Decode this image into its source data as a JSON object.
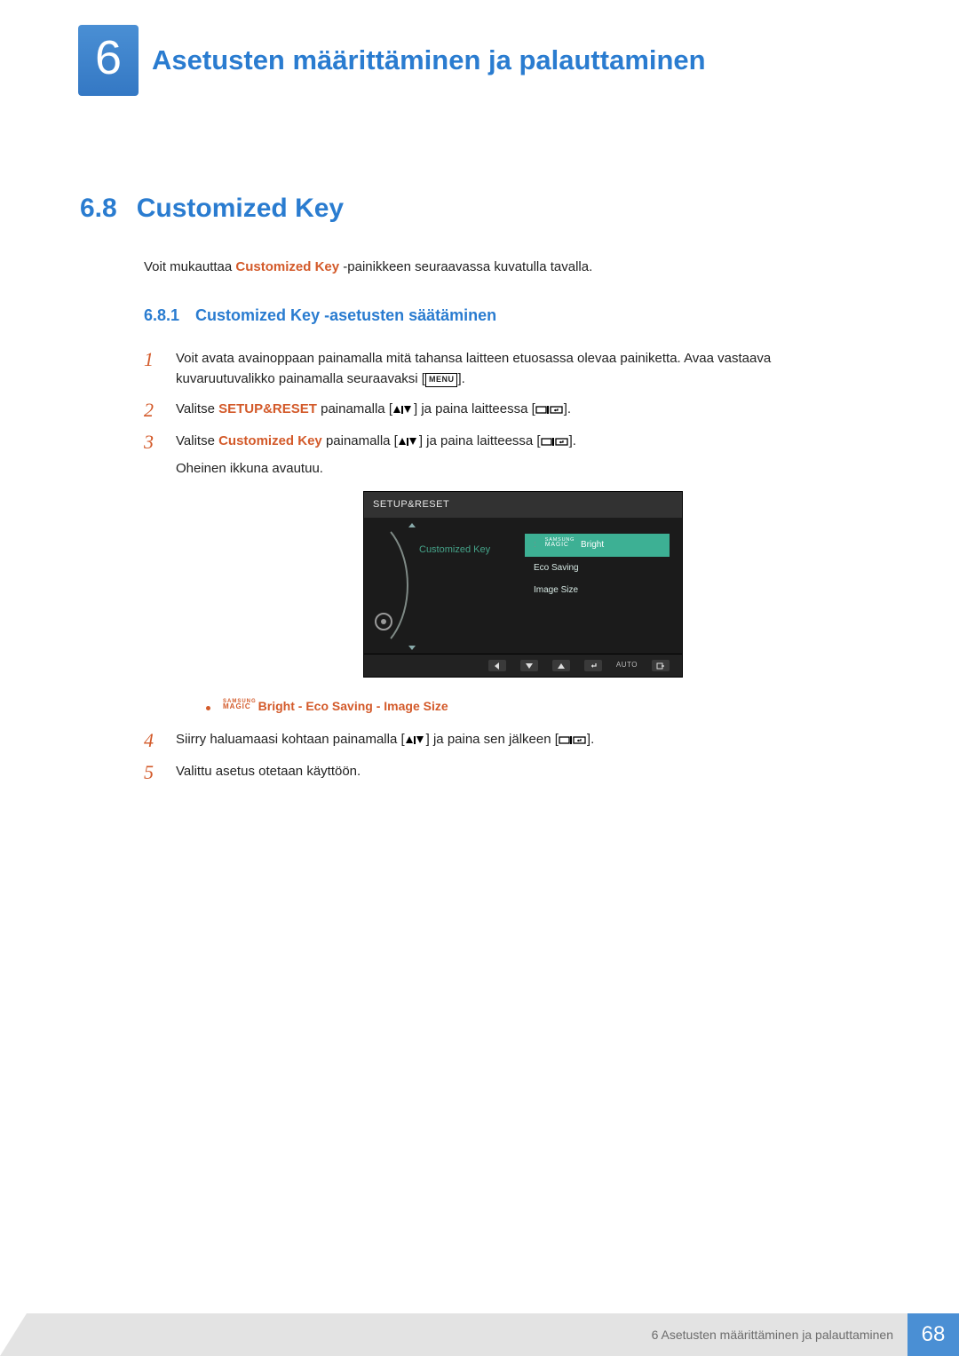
{
  "chapter": {
    "number": "6",
    "title": "Asetusten määrittäminen ja palauttaminen"
  },
  "section": {
    "number": "6.8",
    "title": "Customized Key"
  },
  "intro": {
    "before": "Voit mukauttaa ",
    "strong": "Customized Key",
    "after": " -painikkeen seuraavassa kuvatulla tavalla."
  },
  "subsection": {
    "number": "6.8.1",
    "title": "Customized Key -asetusten säätäminen"
  },
  "steps": {
    "1": {
      "num": "1",
      "body": "Voit avata avainoppaan painamalla mitä tahansa laitteen etuosassa olevaa painiketta. Avaa vastaava kuvaruutuvalikko painamalla seuraavaksi [",
      "menu": "MENU",
      "body2": "]."
    },
    "2": {
      "num": "2",
      "before": "Valitse ",
      "hl": "SETUP&RESET",
      "mid": " painamalla [",
      "mid2": "] ja paina laitteessa [",
      "end": "]."
    },
    "3": {
      "num": "3",
      "before": "Valitse ",
      "hl": "Customized Key",
      "mid": " painamalla [",
      "mid2": "] ja paina laitteessa [",
      "end": "].",
      "extra": "Oheinen ikkuna avautuu."
    },
    "4": {
      "num": "4",
      "before": "Siirry haluamaasi kohtaan painamalla [",
      "mid2": "] ja paina sen jälkeen [",
      "end": "]."
    },
    "5": {
      "num": "5",
      "text": "Valittu asetus otetaan käyttöön."
    }
  },
  "osd": {
    "header": "SETUP&RESET",
    "left_label": "Customized Key",
    "options": [
      "Bright",
      "Eco Saving",
      "Image Size"
    ],
    "magic_top": "SAMSUNG",
    "magic_bottom": "MAGIC",
    "footer_auto": "AUTO"
  },
  "bullet": {
    "magic_top": "SAMSUNG",
    "magic_bottom": "MAGIC",
    "opt1": "Bright",
    "sep": " - ",
    "opt2": "Eco Saving",
    "opt3": "Image Size"
  },
  "footer": {
    "text": "6 Asetusten määrittäminen ja palauttaminen",
    "page": "68"
  }
}
